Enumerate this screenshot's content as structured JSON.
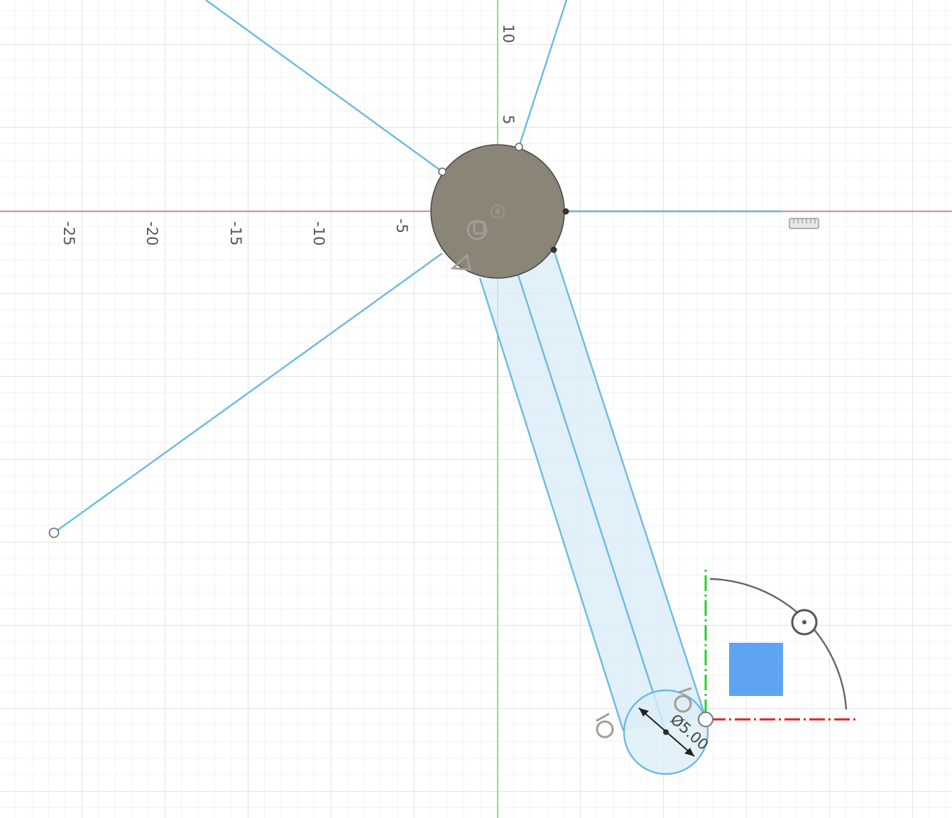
{
  "axes": {
    "x_tick_labels": [
      "-25",
      "-20",
      "-15",
      "-10",
      "-5"
    ],
    "y_tick_labels": [
      "10",
      "5"
    ]
  },
  "dimension": {
    "diameter_label": "Ø5.00"
  },
  "icons": {
    "constraint_icon": "tangent-constraint-icon",
    "coincident_icon": "coincident-constraint-icon",
    "center_icon": "center-point-icon",
    "rotate_handle": "rotate-handle-icon",
    "plane_handle": "plane-move-handle-icon",
    "ruler_icon": "ruler-icon"
  },
  "colors": {
    "sketch_line": "#6cbbe0",
    "profile_fill": "#8a8576",
    "x_axis": "#e05555",
    "y_axis": "#49c949",
    "manipulator_x": "#e22222",
    "manipulator_y": "#28d028",
    "plane_handle": "#5ea4f2"
  }
}
